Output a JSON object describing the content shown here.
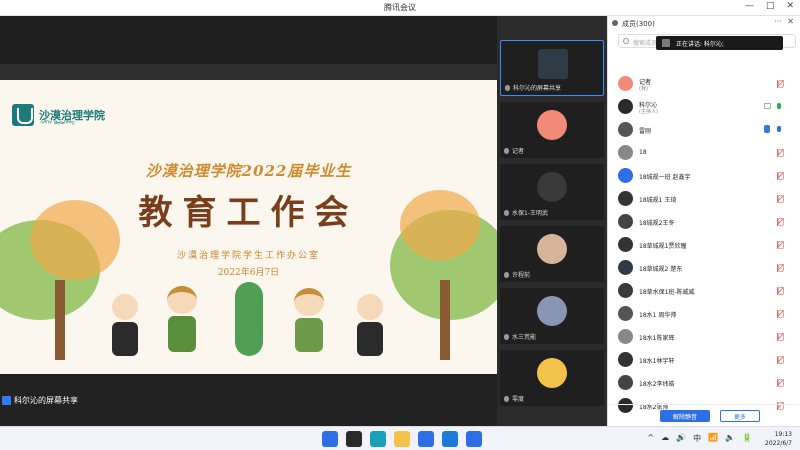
{
  "window": {
    "title": "腾讯会议",
    "controls": [
      "—",
      "□",
      "✕"
    ]
  },
  "slide": {
    "logo_text": "沙漠治理学院",
    "logo_sub": "ᠰᠠᠯᠬᠢᠨ ᠬᠦᠷᠦᠭᠡᠯᠡᠩ",
    "title_line1": "沙漠治理学院2022届毕业生",
    "title_line2": "教育工作会",
    "subtitle": "沙漠治理学院学生工作办公室",
    "date": "2022年6月7日"
  },
  "share_label": "科尔沁的屏幕共享",
  "video_tiles": [
    {
      "name": "科尔沁的屏幕共享",
      "color": "#2f3b47",
      "active": true
    },
    {
      "name": "记者",
      "color": "#f28a7a"
    },
    {
      "name": "水保1-王明武",
      "color": "#3a3a3a"
    },
    {
      "name": "许程前",
      "color": "#d8b49a"
    },
    {
      "name": "水三荒能",
      "color": "#8a94b3"
    },
    {
      "name": "零度",
      "color": "#f2c24a"
    }
  ],
  "panel": {
    "header": "成员(300)",
    "search_placeholder": "搜索成员",
    "speaking": "正在讲话: 科尔沁;",
    "members": [
      {
        "name": "记者",
        "role": "(我)",
        "color": "#f28a7a",
        "mic": "muted",
        "cam": false
      },
      {
        "name": "科尔沁",
        "role": "(主持人)",
        "color": "#2a2a2a",
        "mic": "on",
        "cam": true
      },
      {
        "name": "雷刚",
        "role": "",
        "color": "#555555",
        "mic": "blue",
        "hand": true
      },
      {
        "name": "18",
        "role": "",
        "color": "#888888",
        "mic": "muted"
      },
      {
        "name": "18城规一班 赵鑫宇",
        "role": "",
        "color": "#2f6fe6",
        "mic": "muted"
      },
      {
        "name": "18城规1 王琦",
        "role": "",
        "color": "#333333",
        "mic": "muted"
      },
      {
        "name": "18城规2王冬",
        "role": "",
        "color": "#444444",
        "mic": "muted"
      },
      {
        "name": "18草城规1贾欣瞳",
        "role": "",
        "color": "#333333",
        "mic": "muted"
      },
      {
        "name": "18草城规2 楚东",
        "role": "",
        "color": "#2f3b47",
        "mic": "muted"
      },
      {
        "name": "18草水保1班-陈威威",
        "role": "",
        "color": "#3a3a3a",
        "mic": "muted"
      },
      {
        "name": "18水1 周华帅",
        "role": "",
        "color": "#555555",
        "mic": "muted"
      },
      {
        "name": "18水1陈家辉",
        "role": "",
        "color": "#888888",
        "mic": "muted"
      },
      {
        "name": "18水1林宇轩",
        "role": "",
        "color": "#333333",
        "mic": "muted"
      },
      {
        "name": "18水2李纬皓",
        "role": "",
        "color": "#444444",
        "mic": "muted"
      },
      {
        "name": "18水2张帅",
        "role": "",
        "color": "#2a2a2a",
        "mic": "muted"
      }
    ],
    "unmute_all": "解除静音",
    "more": "更多"
  },
  "taskbar": {
    "apps": [
      {
        "name": "start",
        "color": "#2f6fe6"
      },
      {
        "name": "taskview",
        "color": "#2a2a2a"
      },
      {
        "name": "edge",
        "color": "#1aa0b8"
      },
      {
        "name": "explorer",
        "color": "#f2c24a"
      },
      {
        "name": "mail",
        "color": "#2f6fe6"
      },
      {
        "name": "store",
        "color": "#1c7ad8"
      },
      {
        "name": "meeting",
        "color": "#2f6fe6"
      }
    ],
    "tray": [
      "^",
      "☁",
      "🔊",
      "中",
      "📶",
      "🔈",
      "🔋"
    ],
    "time": "19:13",
    "date": "2022/6/7"
  }
}
